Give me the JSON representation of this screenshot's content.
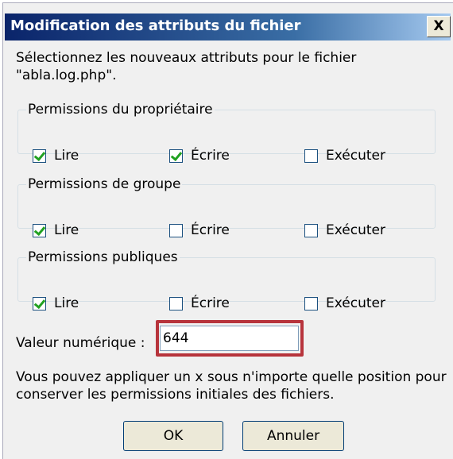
{
  "window": {
    "title": "Modification des attributs du fichier",
    "close_label": "X"
  },
  "intro_text": "Sélectionnez les nouveaux attributs pour le fichier\n\"abla.log.php\".",
  "groups": [
    {
      "legend": "Permissions du propriétaire",
      "items": [
        {
          "label": "Lire",
          "checked": true
        },
        {
          "label": "Écrire",
          "checked": true
        },
        {
          "label": "Exécuter",
          "checked": false
        }
      ]
    },
    {
      "legend": "Permissions de groupe",
      "items": [
        {
          "label": "Lire",
          "checked": true
        },
        {
          "label": "Écrire",
          "checked": false
        },
        {
          "label": "Exécuter",
          "checked": false
        }
      ]
    },
    {
      "legend": "Permissions publiques",
      "items": [
        {
          "label": "Lire",
          "checked": true
        },
        {
          "label": "Écrire",
          "checked": false
        },
        {
          "label": "Exécuter",
          "checked": false
        }
      ]
    }
  ],
  "numeric": {
    "label": "Valeur numérique :",
    "value": "644",
    "highlight_color": "#b7343c"
  },
  "note_text": "Vous pouvez appliquer un x sous n'importe quelle position pour\nconserver les permissions initiales des fichiers.",
  "buttons": {
    "ok": "OK",
    "cancel": "Annuler"
  }
}
